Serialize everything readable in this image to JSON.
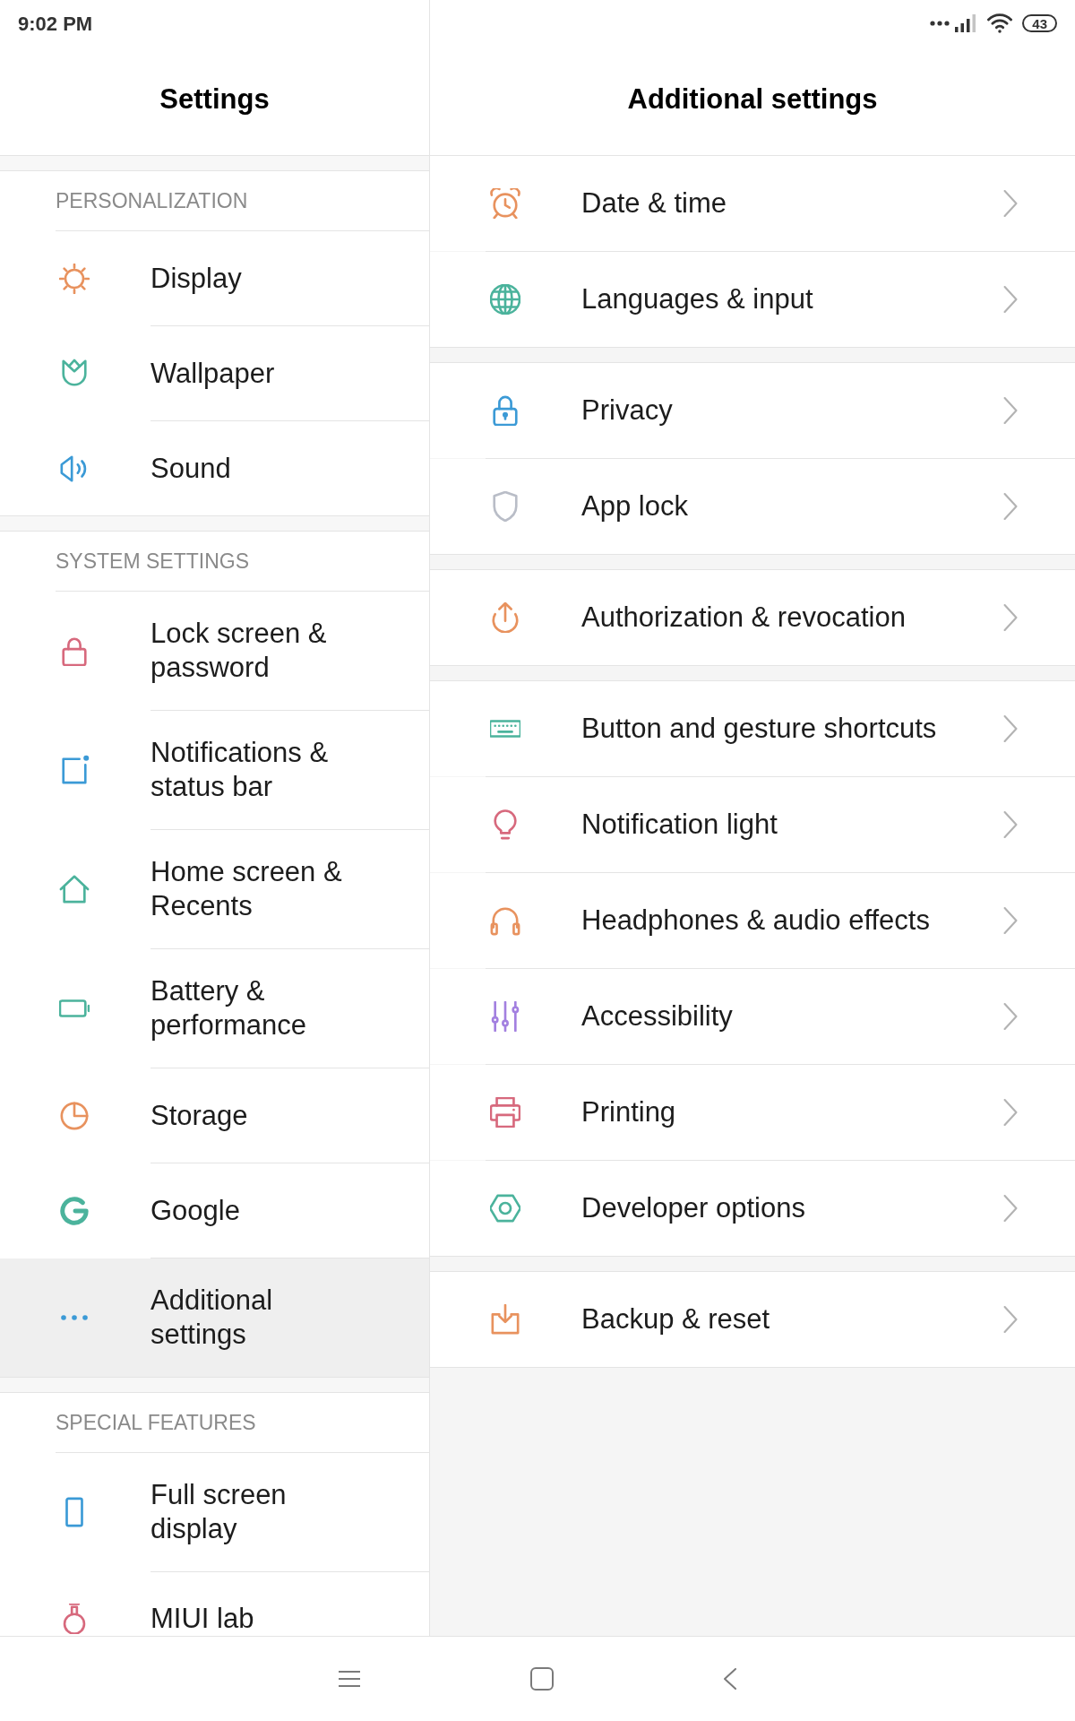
{
  "status_bar": {
    "time": "9:02 PM",
    "battery": "43"
  },
  "settings_pane": {
    "title": "Settings",
    "sections": [
      {
        "title": "PERSONALIZATION",
        "items": [
          {
            "label": "Display",
            "selected": false
          },
          {
            "label": "Wallpaper",
            "selected": false
          },
          {
            "label": "Sound",
            "selected": false
          }
        ]
      },
      {
        "title": "SYSTEM SETTINGS",
        "items": [
          {
            "label": "Lock screen & password",
            "selected": false
          },
          {
            "label": "Notifications & status bar",
            "selected": false
          },
          {
            "label": "Home screen & Recents",
            "selected": false
          },
          {
            "label": "Battery & performance",
            "selected": false
          },
          {
            "label": "Storage",
            "selected": false
          },
          {
            "label": "Google",
            "selected": false
          },
          {
            "label": "Additional settings",
            "selected": true
          }
        ]
      },
      {
        "title": "SPECIAL FEATURES",
        "items": [
          {
            "label": "Full screen display",
            "selected": false
          },
          {
            "label": "MIUI lab",
            "selected": false
          }
        ]
      }
    ]
  },
  "detail_pane": {
    "title": "Additional settings",
    "groups": [
      {
        "items": [
          {
            "label": "Date & time"
          },
          {
            "label": "Languages & input"
          }
        ]
      },
      {
        "items": [
          {
            "label": "Privacy"
          },
          {
            "label": "App lock"
          }
        ]
      },
      {
        "items": [
          {
            "label": "Authorization & revocation"
          }
        ]
      },
      {
        "items": [
          {
            "label": "Button and gesture shortcuts"
          },
          {
            "label": "Notification light"
          },
          {
            "label": "Headphones & audio effects"
          },
          {
            "label": "Accessibility"
          },
          {
            "label": "Printing"
          },
          {
            "label": "Developer options"
          }
        ]
      },
      {
        "items": [
          {
            "label": "Backup & reset"
          }
        ]
      }
    ]
  }
}
